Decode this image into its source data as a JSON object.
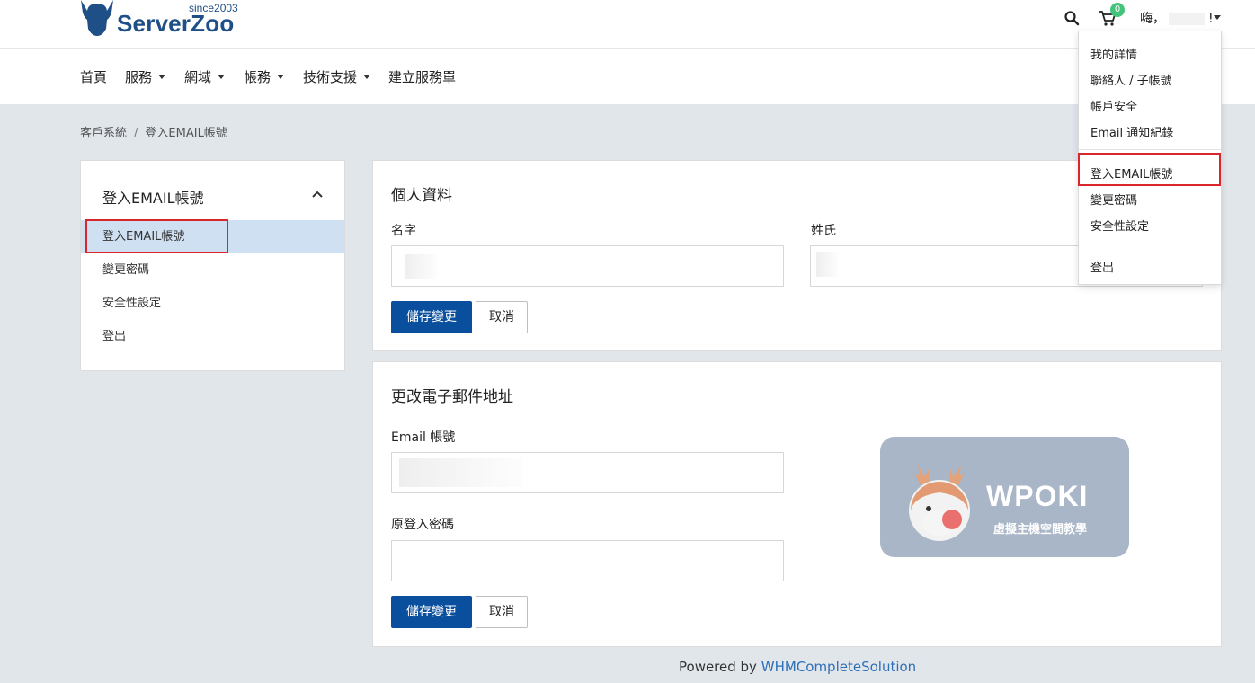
{
  "header": {
    "logo_name": "ServerZoo",
    "logo_since": "since2003",
    "cart_count": "0",
    "greeting_prefix": "嗨，",
    "greeting_suffix": "!"
  },
  "nav": {
    "items": [
      {
        "label": "首頁"
      },
      {
        "label": "服務"
      },
      {
        "label": "網域"
      },
      {
        "label": "帳務"
      },
      {
        "label": "技術支援"
      },
      {
        "label": "建立服務單"
      }
    ]
  },
  "breadcrumb": {
    "root": "客戶系統",
    "separator": "/",
    "current": "登入EMAIL帳號"
  },
  "sidebar": {
    "title": "登入EMAIL帳號",
    "items": [
      {
        "label": "登入EMAIL帳號"
      },
      {
        "label": "變更密碼"
      },
      {
        "label": "安全性設定"
      },
      {
        "label": "登出"
      }
    ]
  },
  "profile_card": {
    "title": "個人資料",
    "first_name_label": "名字",
    "last_name_label": "姓氏",
    "save_label": "儲存變更",
    "cancel_label": "取消"
  },
  "email_card": {
    "title": "更改電子郵件地址",
    "email_label": "Email 帳號",
    "password_label": "原登入密碼",
    "save_label": "儲存變更",
    "cancel_label": "取消"
  },
  "watermark": {
    "brand": "WPOKI",
    "tagline": "虛擬主機空間教學"
  },
  "user_dropdown": {
    "items": [
      {
        "label": "我的詳情"
      },
      {
        "label": "聯絡人 / 子帳號"
      },
      {
        "label": "帳戶安全"
      },
      {
        "label": "Email 通知紀錄"
      },
      {
        "label": "登入EMAIL帳號"
      },
      {
        "label": "變更密碼"
      },
      {
        "label": "安全性設定"
      },
      {
        "label": "登出"
      }
    ]
  },
  "footer": {
    "prefix": "Powered by",
    "link": "WHMCompleteSolution"
  },
  "colors": {
    "brand": "#1e4f86",
    "primary_button": "#0a4f9d",
    "highlight_box": "#d9262c",
    "active_item_bg": "#cfe0f3",
    "page_bg": "#e1e6eb"
  }
}
